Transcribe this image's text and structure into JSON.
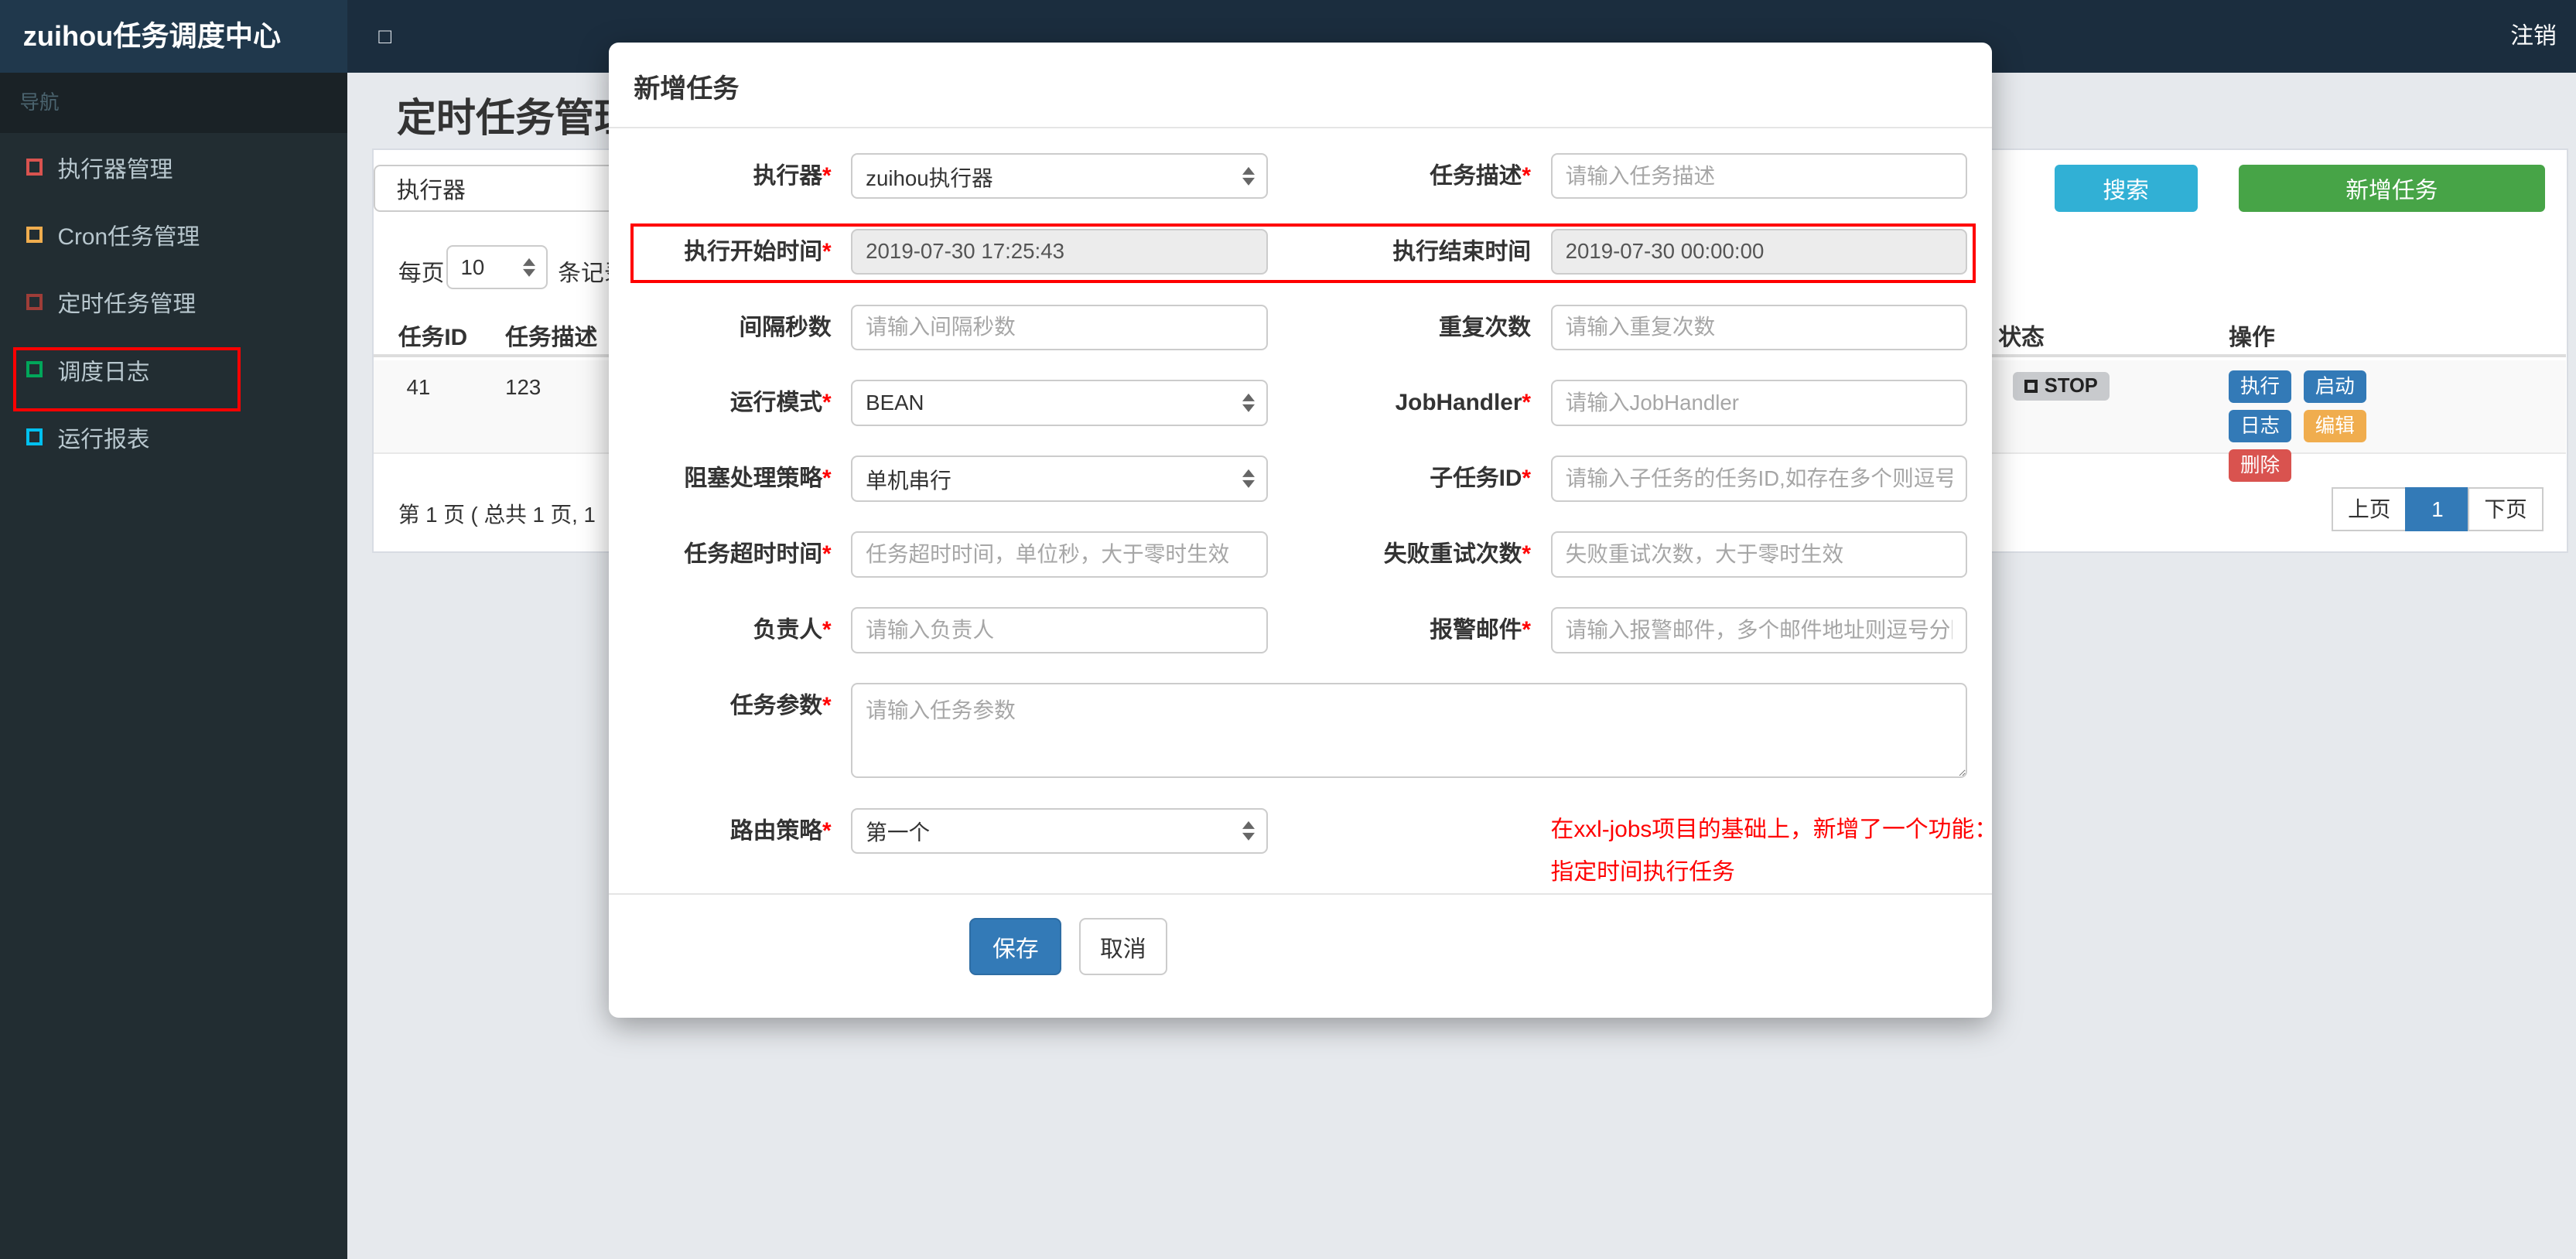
{
  "navbar": {
    "brand": "zuihou任务调度中心",
    "toggle_icon": "□",
    "logout": "注销"
  },
  "sidebar": {
    "section": "导航",
    "items": [
      {
        "label": "执行器管理",
        "icon_color": "#d9534f"
      },
      {
        "label": "Cron任务管理",
        "icon_color": "#f0ad4e"
      },
      {
        "label": "定时任务管理",
        "icon_color": "#9e3d38"
      },
      {
        "label": "调度日志",
        "icon_color": "#00a65a"
      },
      {
        "label": "运行报表",
        "icon_color": "#00c0ef"
      }
    ]
  },
  "page": {
    "title": "定时任务管理"
  },
  "toolbar": {
    "filter_addon": "执行器",
    "search_label": "搜索",
    "search_color": "#31b0d5",
    "add_label": "新增任务",
    "add_color": "#47a447"
  },
  "perpage": {
    "label": "每页",
    "value": "10",
    "suffix": "条记录"
  },
  "table": {
    "headers": [
      "任务ID",
      "任务描述",
      "状态",
      "操作"
    ],
    "row": {
      "id": "41",
      "desc": "123",
      "status": "STOP",
      "actions": [
        {
          "label": "执行",
          "color": "#337ab7"
        },
        {
          "label": "启动",
          "color": "#337ab7"
        },
        {
          "label": "日志",
          "color": "#337ab7"
        },
        {
          "label": "编辑",
          "color": "#f0ad4e"
        },
        {
          "label": "删除",
          "color": "#d9534f"
        }
      ]
    }
  },
  "footer": {
    "info": "第 1 页 ( 总共 1 页, 1",
    "prev": "上页",
    "page": "1",
    "next": "下页"
  },
  "modal": {
    "title": "新增任务",
    "rows": [
      {
        "left": {
          "label": "执行器",
          "star": "*",
          "type": "select",
          "value": "zuihou执行器"
        },
        "right": {
          "label": "任务描述",
          "star": "*",
          "type": "input",
          "placeholder": "请输入任务描述"
        }
      },
      {
        "left": {
          "label": "执行开始时间",
          "star": "*",
          "type": "readonly",
          "value": "2019-07-30 17:25:43"
        },
        "right": {
          "label": "执行结束时间",
          "star": "",
          "type": "readonly",
          "value": "2019-07-30 00:00:00"
        }
      },
      {
        "left": {
          "label": "间隔秒数",
          "star": "",
          "type": "input",
          "placeholder": "请输入间隔秒数"
        },
        "right": {
          "label": "重复次数",
          "star": "",
          "type": "input",
          "placeholder": "请输入重复次数"
        }
      },
      {
        "left": {
          "label": "运行模式",
          "star": "*",
          "type": "select",
          "value": "BEAN"
        },
        "right": {
          "label": "JobHandler",
          "star": "*",
          "type": "input",
          "placeholder": "请输入JobHandler"
        }
      },
      {
        "left": {
          "label": "阻塞处理策略",
          "star": "*",
          "type": "select",
          "value": "单机串行"
        },
        "right": {
          "label": "子任务ID",
          "star": "*",
          "type": "input",
          "placeholder": "请输入子任务的任务ID,如存在多个则逗号分隔"
        }
      },
      {
        "left": {
          "label": "任务超时时间",
          "star": "*",
          "type": "input",
          "placeholder": "任务超时时间，单位秒，大于零时生效"
        },
        "right": {
          "label": "失败重试次数",
          "star": "*",
          "type": "input",
          "placeholder": "失败重试次数，大于零时生效"
        }
      },
      {
        "left": {
          "label": "负责人",
          "star": "*",
          "type": "input",
          "placeholder": "请输入负责人"
        },
        "right": {
          "label": "报警邮件",
          "star": "*",
          "type": "input",
          "placeholder": "请输入报警邮件，多个邮件地址则逗号分隔"
        }
      }
    ],
    "textarea_row": {
      "label": "任务参数",
      "star": "*",
      "placeholder": "请输入任务参数"
    },
    "route_row": {
      "label": "路由策略",
      "star": "*",
      "value": "第一个",
      "note_line1": "在xxl-jobs项目的基础上，新增了一个功能：",
      "note_line2": "指定时间执行任务",
      "note_color": "#ff0000"
    },
    "save_label": "保存",
    "save_color": "#337ab7",
    "cancel_label": "取消",
    "highlight_color": "#ff0000"
  }
}
